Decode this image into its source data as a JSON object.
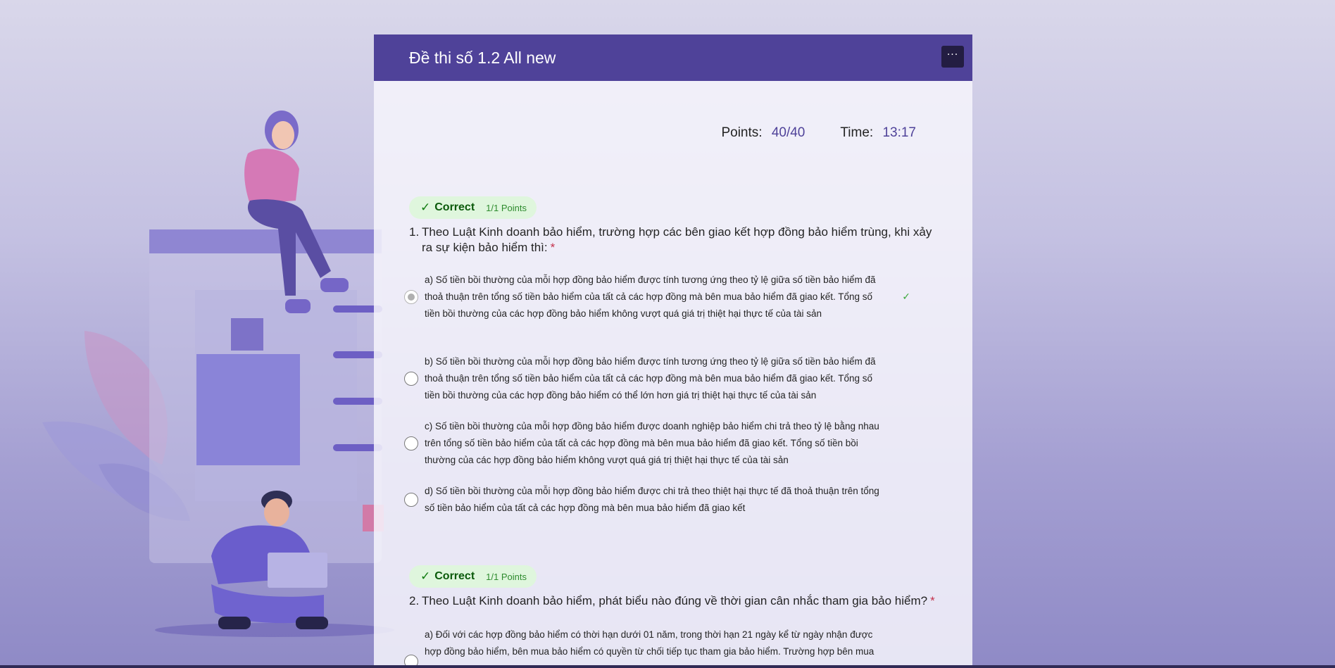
{
  "form": {
    "title": "Đề thi số 1.2 All new",
    "more_label": "···"
  },
  "stats": {
    "points_label": "Points:",
    "points_value": "40/40",
    "time_label": "Time:",
    "time_value": "13:17"
  },
  "questions": [
    {
      "badge_status": "Correct",
      "badge_points": "1/1 Points",
      "number": "1.",
      "text": "Theo Luật Kinh doanh bảo hiểm, trường hợp các bên giao kết hợp đồng bảo hiểm trùng, khi xảy ra sự kiện bảo hiểm thì:",
      "required_mark": "*",
      "options": [
        {
          "text": "a) Số tiền bồi thường của mỗi hợp đồng bảo hiểm được tính tương ứng theo tỷ lệ giữa số tiền bảo hiểm đã thoả thuận trên tổng số tiền bảo hiểm của tất cả các hợp đồng mà bên mua bảo hiểm đã giao kết. Tổng số tiền bồi thường của các hợp đồng bảo hiểm không vượt quá giá trị thiệt hại thực tế của tài sản",
          "selected": true,
          "correct_mark": "✓"
        },
        {
          "text": "b) Số tiền bồi thường của mỗi hợp đồng bảo hiểm được tính tương ứng theo tỷ lệ giữa số tiền bảo hiểm đã thoả thuận trên tổng số tiền bảo hiểm của tất cả các hợp đồng mà bên mua bảo hiểm đã giao kết. Tổng số tiền bồi thường của các hợp đồng bảo hiểm có thể lớn hơn giá trị thiệt hại thực tế của tài sản",
          "selected": false
        },
        {
          "text": "c) Số tiền bồi thường của mỗi hợp đồng bảo hiểm được doanh nghiệp bảo hiểm chi trả theo tỷ lệ bằng nhau trên tổng số tiền bảo hiểm của tất cả các hợp đồng mà bên mua bảo hiểm đã giao kết. Tổng số tiền bồi thường của các hợp đồng bảo hiểm không vượt quá giá trị thiệt hại thực tế của tài sản",
          "selected": false
        },
        {
          "text": "d) Số tiền bồi thường của mỗi hợp đồng bảo hiểm được chi trả theo thiệt hại thực tế đã thoả thuận trên tổng số tiền bảo hiểm của tất cả các hợp đồng mà bên mua bảo hiểm đã giao kết",
          "selected": false
        }
      ]
    },
    {
      "badge_status": "Correct",
      "badge_points": "1/1 Points",
      "number": "2.",
      "text": "Theo Luật Kinh doanh bảo hiểm, phát biểu nào đúng về thời gian cân nhắc tham gia bảo hiểm?",
      "required_mark": "*",
      "options": [
        {
          "text": "a) Đối với các hợp đồng bảo hiểm có thời hạn dưới 01 năm, trong thời hạn 21 ngày kể từ ngày nhận được hợp đồng bảo hiểm, bên mua bảo hiểm có quyền từ chối tiếp tục tham gia bảo hiểm. Trường hợp bên mua",
          "selected": false
        }
      ]
    }
  ],
  "colors": {
    "header": "#4f4299",
    "accent": "#4f4299",
    "correct_bg": "#dff6dd",
    "correct_text": "#107c10",
    "required": "#c4314b"
  }
}
